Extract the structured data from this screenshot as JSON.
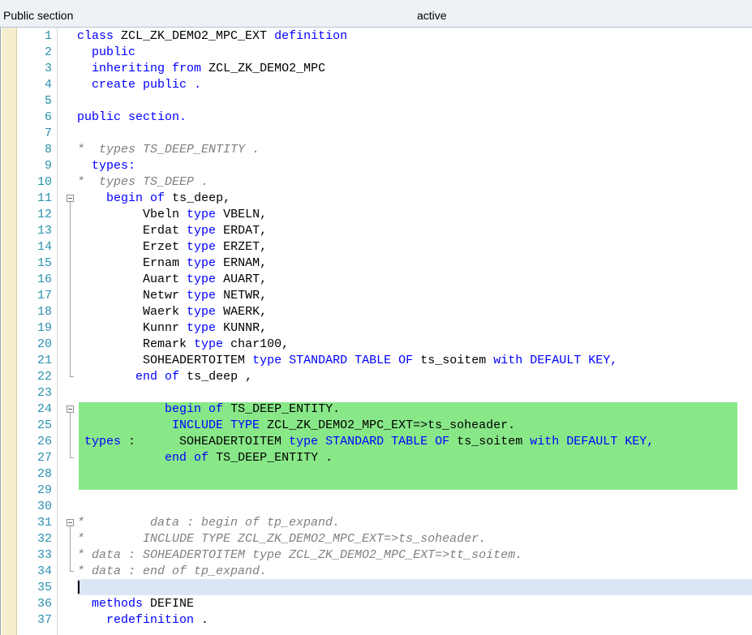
{
  "statusbar": {
    "section": "Public section",
    "status": "active"
  },
  "editor": {
    "lines": [
      {
        "n": "1",
        "segs": [
          [
            "kw",
            "class"
          ],
          [
            "",
            "ZCL_ZK_DEMO2_MPC_EXT"
          ],
          [
            "kw",
            "definition"
          ]
        ]
      },
      {
        "n": "2",
        "segs": [
          [
            "kw",
            "  public"
          ]
        ]
      },
      {
        "n": "3",
        "segs": [
          [
            "kw",
            "  inheriting"
          ],
          [
            "kw",
            "from"
          ],
          [
            "",
            "ZCL_ZK_DEMO2_MPC"
          ]
        ]
      },
      {
        "n": "4",
        "segs": [
          [
            "kw",
            "  create"
          ],
          [
            "kw",
            "public"
          ],
          [
            "kw",
            "."
          ]
        ]
      },
      {
        "n": "5",
        "segs": []
      },
      {
        "n": "6",
        "segs": [
          [
            "kw",
            "public"
          ],
          [
            "kw",
            "section."
          ]
        ]
      },
      {
        "n": "7",
        "segs": []
      },
      {
        "n": "8",
        "segs": [
          [
            "cm",
            "*  types TS_DEEP_ENTITY ."
          ]
        ]
      },
      {
        "n": "9",
        "segs": [
          [
            "kw",
            "  types:"
          ]
        ]
      },
      {
        "n": "10",
        "segs": [
          [
            "cm",
            "*  types TS_DEEP ."
          ]
        ]
      },
      {
        "n": "11",
        "segs": [
          [
            "kw",
            "    begin"
          ],
          [
            "kw",
            "of"
          ],
          [
            "",
            "ts_deep,"
          ]
        ]
      },
      {
        "n": "12",
        "segs": [
          [
            "",
            "         Vbeln"
          ],
          [
            "kw",
            "type"
          ],
          [
            "",
            "VBELN,"
          ]
        ]
      },
      {
        "n": "13",
        "segs": [
          [
            "",
            "         Erdat"
          ],
          [
            "kw",
            "type"
          ],
          [
            "",
            "ERDAT,"
          ]
        ]
      },
      {
        "n": "14",
        "segs": [
          [
            "",
            "         Erzet"
          ],
          [
            "kw",
            "type"
          ],
          [
            "",
            "ERZET,"
          ]
        ]
      },
      {
        "n": "15",
        "segs": [
          [
            "",
            "         Ernam"
          ],
          [
            "kw",
            "type"
          ],
          [
            "",
            "ERNAM,"
          ]
        ]
      },
      {
        "n": "16",
        "segs": [
          [
            "",
            "         Auart"
          ],
          [
            "kw",
            "type"
          ],
          [
            "",
            "AUART,"
          ]
        ]
      },
      {
        "n": "17",
        "segs": [
          [
            "",
            "         Netwr"
          ],
          [
            "kw",
            "type"
          ],
          [
            "",
            "NETWR,"
          ]
        ]
      },
      {
        "n": "18",
        "segs": [
          [
            "",
            "         Waerk"
          ],
          [
            "kw",
            "type"
          ],
          [
            "",
            "WAERK,"
          ]
        ]
      },
      {
        "n": "19",
        "segs": [
          [
            "",
            "         Kunnr"
          ],
          [
            "kw",
            "type"
          ],
          [
            "",
            "KUNNR,"
          ]
        ]
      },
      {
        "n": "20",
        "segs": [
          [
            "",
            "         Remark"
          ],
          [
            "kw",
            "type"
          ],
          [
            "",
            "char100,"
          ]
        ]
      },
      {
        "n": "21",
        "segs": [
          [
            "",
            "         SOHEADERTOITEM"
          ],
          [
            "kw",
            "type"
          ],
          [
            "kw",
            "STANDARD"
          ],
          [
            "kw",
            "TABLE"
          ],
          [
            "kw",
            "OF"
          ],
          [
            "",
            "ts_soitem"
          ],
          [
            "kw",
            "with"
          ],
          [
            "kw",
            "DEFAULT"
          ],
          [
            "kw",
            "KEY,"
          ]
        ]
      },
      {
        "n": "22",
        "segs": [
          [
            "kw",
            "        end"
          ],
          [
            "kw",
            "of"
          ],
          [
            "",
            "ts_deep ,"
          ]
        ]
      },
      {
        "n": "23",
        "segs": []
      },
      {
        "n": "24",
        "segs": [
          [
            "kw",
            "            begin"
          ],
          [
            "kw",
            "of"
          ],
          [
            "",
            "TS_DEEP_ENTITY."
          ]
        ]
      },
      {
        "n": "25",
        "segs": [
          [
            "kw",
            "             INCLUDE"
          ],
          [
            "kw",
            "TYPE"
          ],
          [
            "",
            "ZCL_ZK_DEMO2_MPC_EXT=>ts_soheader."
          ]
        ]
      },
      {
        "n": "26",
        "segs": [
          [
            "kw",
            " types"
          ],
          [
            "",
            ":      SOHEADERTOITEM"
          ],
          [
            "kw",
            "type"
          ],
          [
            "kw",
            "STANDARD"
          ],
          [
            "kw",
            "TABLE"
          ],
          [
            "kw",
            "OF"
          ],
          [
            "",
            "ts_soitem"
          ],
          [
            "kw",
            "with"
          ],
          [
            "kw",
            "DEFAULT"
          ],
          [
            "kw",
            "KEY,"
          ]
        ]
      },
      {
        "n": "27",
        "segs": [
          [
            "kw",
            "            end"
          ],
          [
            "kw",
            "of"
          ],
          [
            "",
            "TS_DEEP_ENTITY ."
          ]
        ]
      },
      {
        "n": "28",
        "segs": []
      },
      {
        "n": "29",
        "segs": []
      },
      {
        "n": "30",
        "segs": []
      },
      {
        "n": "31",
        "segs": [
          [
            "cm",
            "*         data : begin of tp_expand."
          ]
        ]
      },
      {
        "n": "32",
        "segs": [
          [
            "cm",
            "*        INCLUDE TYPE ZCL_ZK_DEMO2_MPC_EXT=>ts_soheader."
          ]
        ]
      },
      {
        "n": "33",
        "segs": [
          [
            "cm",
            "* data : SOHEADERTOITEM type ZCL_ZK_DEMO2_MPC_EXT=>tt_soitem."
          ]
        ]
      },
      {
        "n": "34",
        "segs": [
          [
            "cm",
            "* data : end of tp_expand."
          ]
        ]
      },
      {
        "n": "35",
        "segs": []
      },
      {
        "n": "36",
        "segs": [
          [
            "kw",
            "  methods"
          ],
          [
            "",
            "DEFINE"
          ]
        ]
      },
      {
        "n": "37",
        "segs": [
          [
            "kw",
            "    redefinition"
          ],
          [
            "",
            "."
          ]
        ]
      }
    ],
    "folds": [
      {
        "start": "11",
        "end": "22"
      },
      {
        "start": "24",
        "end": "27"
      },
      {
        "start": "31",
        "end": "34"
      }
    ],
    "highlight_color": "#88e888",
    "keyword_color": "#0000ff",
    "comment_color": "#808080",
    "line_number_color": "#2b91af"
  }
}
